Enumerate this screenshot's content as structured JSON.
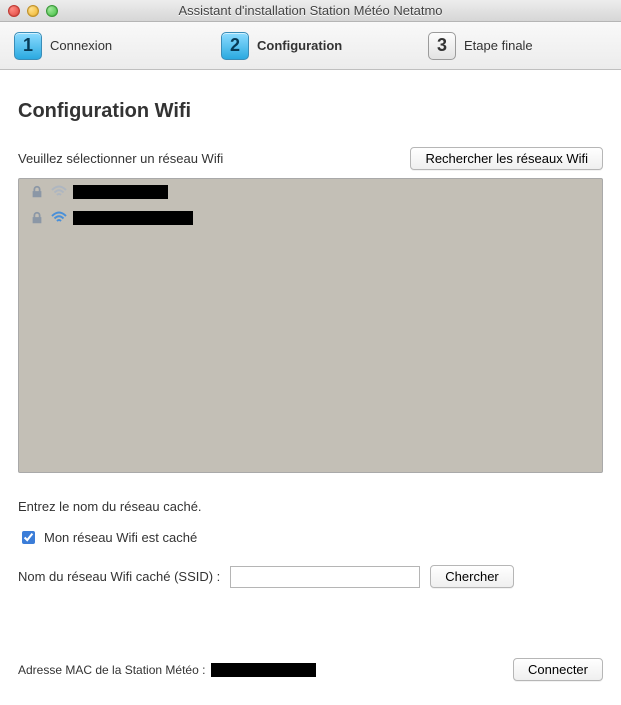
{
  "window": {
    "title": "Assistant d'installation Station Météo Netatmo"
  },
  "steps": {
    "one": {
      "num": "1",
      "label": "Connexion"
    },
    "two": {
      "num": "2",
      "label": "Configuration"
    },
    "three": {
      "num": "3",
      "label": "Etape finale"
    }
  },
  "page": {
    "title": "Configuration Wifi",
    "select_prompt": "Veuillez sélectionner un réseau Wifi",
    "search_button": "Rechercher les réseaux Wifi"
  },
  "networks": [
    {
      "locked": true,
      "signal": "weak"
    },
    {
      "locked": true,
      "signal": "strong"
    }
  ],
  "hidden": {
    "prompt": "Entrez le nom du réseau caché.",
    "checkbox_label": "Mon réseau Wifi est caché",
    "checked": true,
    "ssid_label": "Nom du réseau Wifi caché (SSID) :",
    "ssid_value": "",
    "search_button": "Chercher"
  },
  "footer": {
    "mac_label": "Adresse MAC de la Station Météo :",
    "connect_button": "Connecter"
  }
}
